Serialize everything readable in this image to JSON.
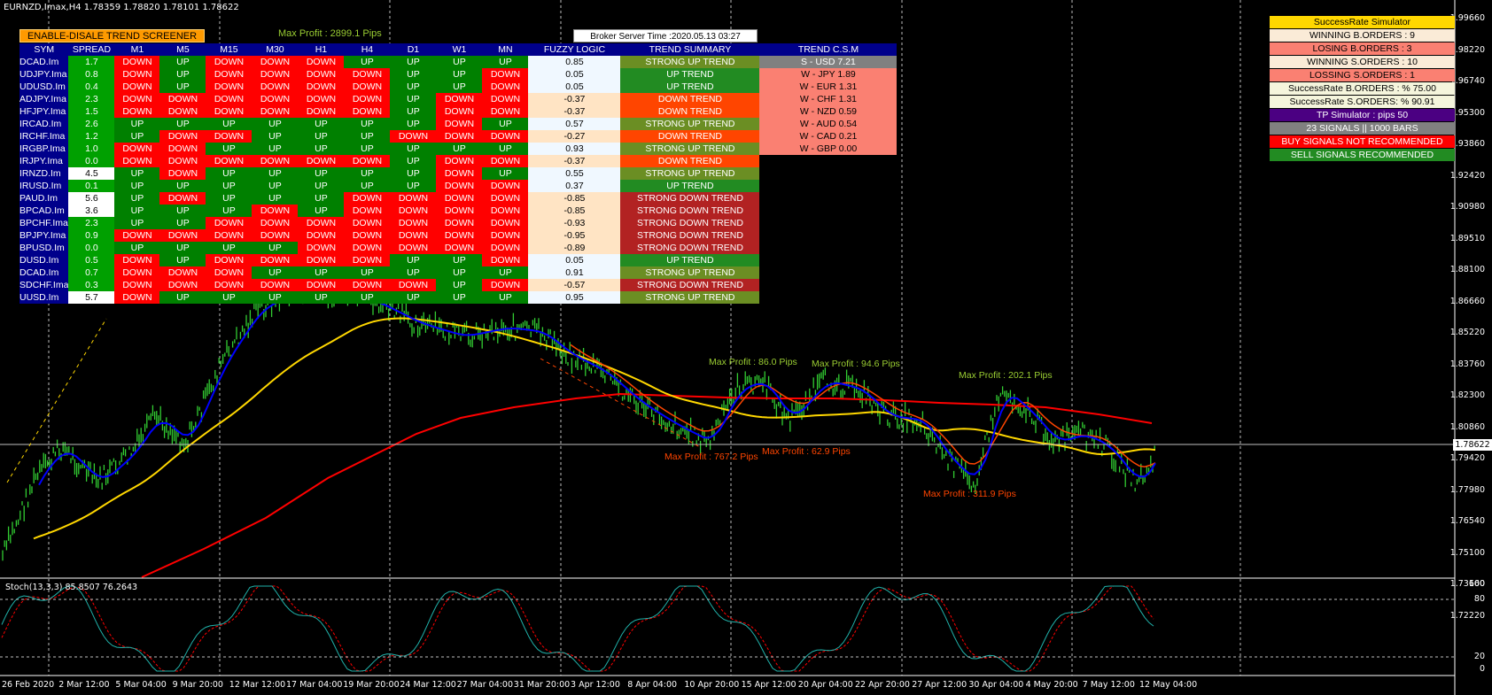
{
  "window": {
    "title": "EURNZD,Imax,H4  1.78359 1.78820 1.78101 1.78622"
  },
  "screener_button": "ENABLE-DISALE TREND SCREENER",
  "max_profit_top": "Max Profit : 2899.1 Pips",
  "broker_time": "Broker Server Time :2020.05.13 03:27",
  "table": {
    "headers": [
      "SYM",
      "SPREAD",
      "M1",
      "M5",
      "M15",
      "M30",
      "H1",
      "H4",
      "D1",
      "W1",
      "MN",
      "FUZZY LOGIC",
      "TREND SUMMARY",
      "TREND C.S.M"
    ],
    "rows": [
      {
        "sym": "DCAD.Im",
        "spread": "1.7",
        "tf": [
          "DOWN",
          "UP",
          "DOWN",
          "DOWN",
          "DOWN",
          "UP",
          "UP",
          "UP",
          "UP"
        ],
        "fuzzy": "0.85",
        "summary": "STRONG UP TREND",
        "csm": "S - USD  7.21"
      },
      {
        "sym": "UDJPY.Ima",
        "spread": "0.8",
        "tf": [
          "DOWN",
          "UP",
          "DOWN",
          "DOWN",
          "DOWN",
          "DOWN",
          "UP",
          "UP",
          "DOWN"
        ],
        "fuzzy": "0.05",
        "summary": "UP TREND",
        "csm": "W - JPY  1.89"
      },
      {
        "sym": "UDUSD.Im",
        "spread": "0.4",
        "tf": [
          "DOWN",
          "UP",
          "DOWN",
          "DOWN",
          "DOWN",
          "DOWN",
          "UP",
          "UP",
          "DOWN"
        ],
        "fuzzy": "0.05",
        "summary": "UP TREND",
        "csm": "W - EUR  1.31"
      },
      {
        "sym": "ADJPY.Ima",
        "spread": "2.3",
        "tf": [
          "DOWN",
          "DOWN",
          "DOWN",
          "DOWN",
          "DOWN",
          "DOWN",
          "UP",
          "DOWN",
          "DOWN"
        ],
        "fuzzy": "-0.37",
        "summary": "DOWN TREND",
        "csm": "W - CHF  1.31"
      },
      {
        "sym": "HFJPY.Ima",
        "spread": "1.5",
        "tf": [
          "DOWN",
          "DOWN",
          "DOWN",
          "DOWN",
          "DOWN",
          "DOWN",
          "UP",
          "DOWN",
          "DOWN"
        ],
        "fuzzy": "-0.37",
        "summary": "DOWN TREND",
        "csm": "W - NZD  0.59"
      },
      {
        "sym": "IRCAD.Im",
        "spread": "2.6",
        "tf": [
          "UP",
          "UP",
          "UP",
          "UP",
          "UP",
          "UP",
          "UP",
          "DOWN",
          "UP"
        ],
        "fuzzy": "0.57",
        "summary": "STRONG UP TREND",
        "csm": "W - AUD  0.54"
      },
      {
        "sym": "IRCHF.Ima",
        "spread": "1.2",
        "tf": [
          "UP",
          "DOWN",
          "DOWN",
          "UP",
          "UP",
          "UP",
          "DOWN",
          "DOWN",
          "DOWN"
        ],
        "fuzzy": "-0.27",
        "summary": "DOWN TREND",
        "csm": "W - CAD  0.21"
      },
      {
        "sym": "IRGBP.Ima",
        "spread": "1.0",
        "tf": [
          "DOWN",
          "DOWN",
          "UP",
          "UP",
          "UP",
          "UP",
          "UP",
          "UP",
          "UP"
        ],
        "fuzzy": "0.93",
        "summary": "STRONG UP TREND",
        "csm": "W - GBP  0.00"
      },
      {
        "sym": "IRJPY.Ima",
        "spread": "0.0",
        "tf": [
          "DOWN",
          "DOWN",
          "DOWN",
          "DOWN",
          "DOWN",
          "DOWN",
          "UP",
          "DOWN",
          "DOWN"
        ],
        "fuzzy": "-0.37",
        "summary": "DOWN TREND",
        "csm": ""
      },
      {
        "sym": "IRNZD.Im",
        "spread": "4.5",
        "tf": [
          "UP",
          "DOWN",
          "UP",
          "UP",
          "UP",
          "UP",
          "UP",
          "DOWN",
          "UP"
        ],
        "fuzzy": "0.55",
        "summary": "STRONG UP TREND",
        "csm": ""
      },
      {
        "sym": "IRUSD.Im",
        "spread": "0.1",
        "tf": [
          "UP",
          "UP",
          "UP",
          "UP",
          "UP",
          "UP",
          "UP",
          "DOWN",
          "DOWN"
        ],
        "fuzzy": "0.37",
        "summary": "UP TREND",
        "csm": ""
      },
      {
        "sym": "PAUD.Im",
        "spread": "5.6",
        "tf": [
          "UP",
          "DOWN",
          "UP",
          "UP",
          "UP",
          "DOWN",
          "DOWN",
          "DOWN",
          "DOWN"
        ],
        "fuzzy": "-0.85",
        "summary": "STRONG DOWN TREND",
        "csm": ""
      },
      {
        "sym": "BPCAD.Im",
        "spread": "3.6",
        "tf": [
          "UP",
          "UP",
          "UP",
          "DOWN",
          "UP",
          "DOWN",
          "DOWN",
          "DOWN",
          "DOWN"
        ],
        "fuzzy": "-0.85",
        "summary": "STRONG DOWN TREND",
        "csm": ""
      },
      {
        "sym": "BPCHF.Ima",
        "spread": "2.3",
        "tf": [
          "UP",
          "UP",
          "DOWN",
          "DOWN",
          "DOWN",
          "DOWN",
          "DOWN",
          "DOWN",
          "DOWN"
        ],
        "fuzzy": "-0.93",
        "summary": "STRONG DOWN TREND",
        "csm": ""
      },
      {
        "sym": "BPJPY.Ima",
        "spread": "0.9",
        "tf": [
          "DOWN",
          "DOWN",
          "DOWN",
          "DOWN",
          "DOWN",
          "DOWN",
          "DOWN",
          "DOWN",
          "DOWN"
        ],
        "fuzzy": "-0.95",
        "summary": "STRONG DOWN TREND",
        "csm": ""
      },
      {
        "sym": "BPUSD.Im",
        "spread": "0.0",
        "tf": [
          "UP",
          "UP",
          "UP",
          "UP",
          "DOWN",
          "DOWN",
          "DOWN",
          "DOWN",
          "DOWN"
        ],
        "fuzzy": "-0.89",
        "summary": "STRONG DOWN TREND",
        "csm": ""
      },
      {
        "sym": "DUSD.Im",
        "spread": "0.5",
        "tf": [
          "DOWN",
          "UP",
          "DOWN",
          "DOWN",
          "DOWN",
          "DOWN",
          "UP",
          "UP",
          "DOWN"
        ],
        "fuzzy": "0.05",
        "summary": "UP TREND",
        "csm": ""
      },
      {
        "sym": "DCAD.Im",
        "spread": "0.7",
        "tf": [
          "DOWN",
          "DOWN",
          "DOWN",
          "UP",
          "UP",
          "UP",
          "UP",
          "UP",
          "UP"
        ],
        "fuzzy": "0.91",
        "summary": "STRONG UP TREND",
        "csm": ""
      },
      {
        "sym": "SDCHF.Ima",
        "spread": "0.3",
        "tf": [
          "DOWN",
          "DOWN",
          "DOWN",
          "DOWN",
          "DOWN",
          "DOWN",
          "DOWN",
          "UP",
          "DOWN"
        ],
        "fuzzy": "-0.57",
        "summary": "STRONG DOWN TREND",
        "csm": ""
      },
      {
        "sym": "UUSD.Im",
        "spread": "5.7",
        "tf": [
          "DOWN",
          "UP",
          "UP",
          "UP",
          "UP",
          "UP",
          "UP",
          "UP",
          "UP"
        ],
        "fuzzy": "0.95",
        "summary": "STRONG UP TREND",
        "csm": ""
      }
    ]
  },
  "success_panel": [
    {
      "label": "SuccessRate Simulator",
      "bg": "#ffd700",
      "fg": "#000000"
    },
    {
      "label": "WINNING B.ORDERS : 9",
      "bg": "#faebd7",
      "fg": "#000000"
    },
    {
      "label": "LOSING B.ORDERS : 3",
      "bg": "#fa8072",
      "fg": "#000000"
    },
    {
      "label": "WINNING S.ORDERS : 10",
      "bg": "#faebd7",
      "fg": "#000000"
    },
    {
      "label": "LOSSING S.ORDERS : 1",
      "bg": "#fa8072",
      "fg": "#000000"
    },
    {
      "label": "SuccessRate B.ORDERS : % 75.00",
      "bg": "#f5f5dc",
      "fg": "#000000"
    },
    {
      "label": "SuccessRate S.ORDERS: % 90.91",
      "bg": "#f5f5dc",
      "fg": "#000000"
    },
    {
      "label": "TP Simulator : pips 50",
      "bg": "#4b0082",
      "fg": "#ffffff"
    },
    {
      "label": "23 SIGNALS || 1000 BARS",
      "bg": "#808080",
      "fg": "#ffffff"
    },
    {
      "label": "BUY SIGNALS NOT RECOMMENDED",
      "bg": "#ff0000",
      "fg": "#ffffff"
    },
    {
      "label": "SELL SIGNALS RECOMMENDED",
      "bg": "#228b22",
      "fg": "#ffffff"
    }
  ],
  "price_axis": [
    "1.99660",
    "1.98220",
    "1.96740",
    "1.95300",
    "1.93860",
    "1.92420",
    "1.90980",
    "1.89510",
    "1.88100",
    "1.86660",
    "1.85220",
    "1.83760",
    "1.82300",
    "1.80860",
    "1.79420",
    "1.77980",
    "1.76540",
    "1.75100",
    "1.73660",
    "1.72220"
  ],
  "current_price": "1.78622",
  "time_axis": [
    "26 Feb 2020",
    "2 Mar 12:00",
    "5 Mar 04:00",
    "9 Mar 20:00",
    "12 Mar 12:00",
    "17 Mar 04:00",
    "19 Mar 20:00",
    "24 Mar 12:00",
    "27 Mar 04:00",
    "31 Mar 20:00",
    "3 Apr 12:00",
    "8 Apr 04:00",
    "10 Apr 20:00",
    "15 Apr 12:00",
    "20 Apr 04:00",
    "22 Apr 20:00",
    "27 Apr 12:00",
    "30 Apr 04:00",
    "4 May 20:00",
    "7 May 12:00",
    "12 May 04:00"
  ],
  "annotations": [
    {
      "text": "Max Profit : 86.0 Pips",
      "color": "#9acd32"
    },
    {
      "text": "Max Profit : 94.6 Pips",
      "color": "#9acd32"
    },
    {
      "text": "Max Profit : 202.1 Pips",
      "color": "#9acd32"
    },
    {
      "text": "Max Profit : 767.2 Pips",
      "color": "#ff4500"
    },
    {
      "text": "Max Profit : 62.9 Pips",
      "color": "#ff4500"
    },
    {
      "text": "Max Profit : 311.9 Pips",
      "color": "#ff4500"
    }
  ],
  "stoch": {
    "label": "Stoch(13,3,3) 85.8507 76.2643",
    "levels": [
      "100",
      "80",
      "20",
      "0"
    ]
  },
  "colors": {
    "ma_fast": "#0000ff",
    "ma_mid": "#ff4500",
    "ma_slow": "#ffd700",
    "ma_long": "#ff0000",
    "candles": "#32cd32",
    "stoch_main": "#20b2aa",
    "stoch_signal": "#ff0000"
  }
}
